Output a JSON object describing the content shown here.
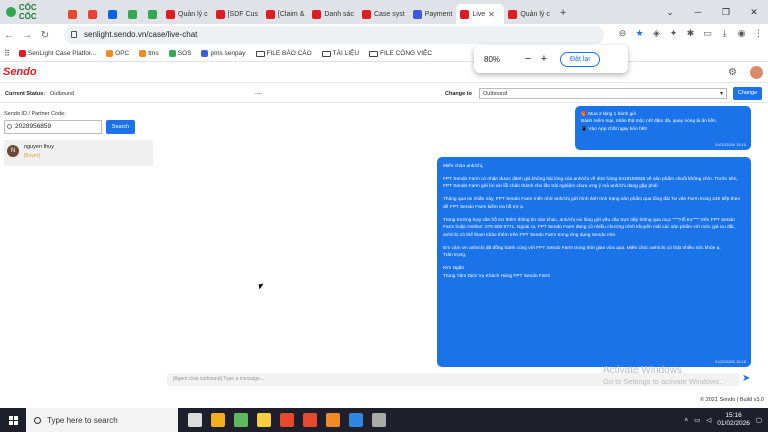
{
  "browser": {
    "brand": "CỐC CỐC",
    "tabs": [
      {
        "label": "",
        "color": "#e8482b"
      },
      {
        "label": "",
        "color": "#ea4335"
      },
      {
        "label": "",
        "color": "#0b63e5"
      },
      {
        "label": "",
        "color": "#34a853"
      },
      {
        "label": "",
        "color": "#34a853"
      },
      {
        "label": "Quản lý c",
        "color": "#e11b22"
      },
      {
        "label": "[SDF Cus",
        "color": "#e11b22"
      },
      {
        "label": "[Claim &",
        "color": "#e11b22"
      },
      {
        "label": "Danh sác",
        "color": "#e11b22"
      },
      {
        "label": "Case syst",
        "color": "#e11b22"
      },
      {
        "label": "Payment",
        "color": "#3b5bdb"
      },
      {
        "label": "Live",
        "color": "#e11b22",
        "active": true
      },
      {
        "label": "Quản lý c",
        "color": "#e11b22"
      }
    ],
    "url": "senlight.sendo.vn/case/live-chat",
    "bookmarks": [
      {
        "label": "SenLight Case Platfor...",
        "color": "#e11b22"
      },
      {
        "label": "OPC",
        "color": "#f08a24"
      },
      {
        "label": "tms",
        "color": "#f08a24"
      },
      {
        "label": "SOS",
        "color": "#34a853"
      },
      {
        "label": "pms senpay",
        "color": "#3b5bdb"
      },
      {
        "label": "FILE BÁO CÁO",
        "folder": true
      },
      {
        "label": "TÀI LIỆU",
        "folder": true
      },
      {
        "label": "FILE CÔNG VIỆC",
        "folder": true
      }
    ],
    "zoom": {
      "value": "80%",
      "minus": "−",
      "plus": "+",
      "reset_label": "Đặt lại"
    }
  },
  "app": {
    "logo": "Sendo",
    "status_bar": {
      "current_status_label": "Current Status:",
      "current_status_value": "Outbound",
      "middle_text": "----",
      "change_to_label": "Change to",
      "change_to_value": "Outbound",
      "change_button": "Change"
    },
    "search": {
      "label": "Sendo ID / Partner Code:",
      "value": "2028956859",
      "button": "Search"
    },
    "conversations": [
      {
        "initial": "N",
        "name": "nguyen thuy",
        "badge": "[Buyer]"
      }
    ],
    "messages": [
      {
        "lines": [
          "🎁 Mua 2 tặng 1 bánh giò",
          "Bánh mềm mại, nhân thịt mộc nhĩ đậm đà, quay nóng là ăn liền.",
          "📱 Vào App chốt ngay kẻo hết!"
        ],
        "time": "01/02/2026 15:10"
      },
      {
        "paragraphs": [
          "Miến chào anh/chị,",
          "FPT Sendo Farm có nhận được đánh giá không hài lòng của anh/chị về đơn hàng 8418193835 về sản phẩm chuối không chín. Trước tiên, FPT Sendo Farm gửi lời xin lỗi chân thành cho lần trải nghiệm chưa ưng ý mà anh/chị đang gặp phải.",
          "Thông qua tin nhắn này, FPT Sendo Farm mến nhờ anh/chị gửi hình ảnh tình trạng sản phẩm qua tổng đài Tư vấn Farm trong 24h tiếp theo để FPT Sendo Farm kiểm tra hỗ trợ ạ.",
          "Trong trường hợp cần hỗ trợ thêm thông tin nào khác, anh/chị vui lòng gửi yêu cầu trực tiếp thông qua mục \"\"\"\"Hỗ trợ\"\"\"\" trên FPT Sendo Farm hoặc Hotline: 076 600 6771. Ngoài ra, FPT Sendo Farm đang có nhiều chương trình khuyến mãi các sản phẩm với mức giá ưu đãi, anh/chị có thể tham khảo thêm trên FPT Sendo Farm trong ứng dụng Sendo nhé.",
          "Em cảm ơn anh/chị đã đồng hành cùng với FPT Sendo Farm trong thời gian vừa qua. Miến chúc anh/chị có thật nhiều sức khỏe ạ.\nTrân trọng,",
          "Kim Ngân\nTrung Tâm Dịch Vụ Khách Hàng FPT Sendo Farm"
        ],
        "time": "01/02/2026 15:16"
      }
    ],
    "composer_placeholder": "[Agent chat outbound] Type a message...",
    "footer": "© 2021 Sendo | Build v3.0",
    "watermark": {
      "title": "Activate Windows",
      "subtitle": "Go to Settings to activate Windows."
    }
  },
  "taskbar": {
    "search_placeholder": "Type here to search",
    "time": "15:16",
    "date": "01/02/2026",
    "apps": [
      "#dcdcdc",
      "#f2b01e",
      "#5fb85f",
      "#f4d03f",
      "#e8482b",
      "#e8482b",
      "#f08a24",
      "#2e86de",
      "#aaaaaa"
    ]
  }
}
